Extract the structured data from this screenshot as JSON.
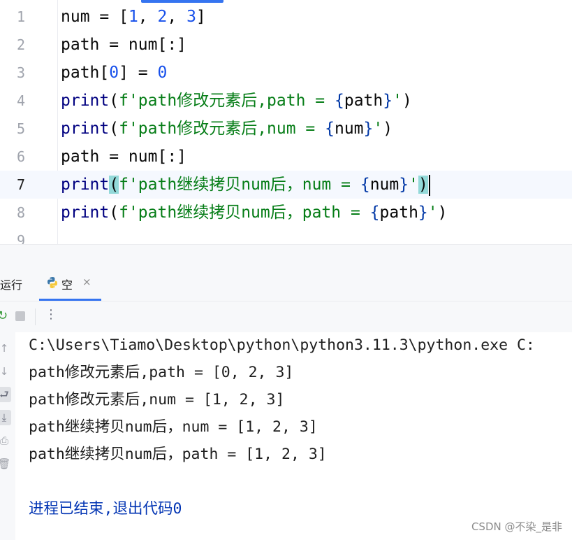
{
  "editor": {
    "current_line": 7,
    "lines": [
      {
        "n": "1",
        "tokens": [
          [
            "plain",
            "num = ["
          ],
          [
            "num",
            "1"
          ],
          [
            "plain",
            ", "
          ],
          [
            "num",
            "2"
          ],
          [
            "plain",
            ", "
          ],
          [
            "num",
            "3"
          ],
          [
            "plain",
            "]"
          ]
        ]
      },
      {
        "n": "2",
        "tokens": [
          [
            "plain",
            "path = num[:]"
          ]
        ]
      },
      {
        "n": "3",
        "tokens": [
          [
            "plain",
            "path["
          ],
          [
            "num",
            "0"
          ],
          [
            "plain",
            "] = "
          ],
          [
            "num",
            "0"
          ]
        ]
      },
      {
        "n": "4",
        "tokens": [
          [
            "kw",
            "print"
          ],
          [
            "plain",
            "("
          ],
          [
            "str",
            "f'path修改元素后,path = "
          ],
          [
            "brace",
            "{"
          ],
          [
            "plain",
            "path"
          ],
          [
            "brace",
            "}"
          ],
          [
            "str",
            "'"
          ],
          [
            "plain",
            ")"
          ]
        ]
      },
      {
        "n": "5",
        "tokens": [
          [
            "kw",
            "print"
          ],
          [
            "plain",
            "("
          ],
          [
            "str",
            "f'path修改元素后,num = "
          ],
          [
            "brace",
            "{"
          ],
          [
            "plain",
            "num"
          ],
          [
            "brace",
            "}"
          ],
          [
            "str",
            "'"
          ],
          [
            "plain",
            ")"
          ]
        ]
      },
      {
        "n": "6",
        "tokens": [
          [
            "plain",
            "path = num[:]"
          ]
        ]
      },
      {
        "n": "7",
        "tokens": [
          [
            "kw",
            "print"
          ],
          [
            "hl",
            "("
          ],
          [
            "str",
            "f'path继续拷贝num后，num = "
          ],
          [
            "brace",
            "{"
          ],
          [
            "plain",
            "num"
          ],
          [
            "brace",
            "}"
          ],
          [
            "str",
            "'"
          ],
          [
            "hl",
            ")"
          ],
          [
            "caret",
            ""
          ]
        ]
      },
      {
        "n": "8",
        "tokens": [
          [
            "kw",
            "print"
          ],
          [
            "plain",
            "("
          ],
          [
            "str",
            "f'path继续拷贝num后，path = "
          ],
          [
            "brace",
            "{"
          ],
          [
            "plain",
            "path"
          ],
          [
            "brace",
            "}"
          ],
          [
            "str",
            "'"
          ],
          [
            "plain",
            ")"
          ]
        ]
      },
      {
        "n": "9",
        "tokens": []
      }
    ]
  },
  "run_panel": {
    "title": "运行",
    "tab_label": "空",
    "tab_icon": "python-icon",
    "tab_close": "×",
    "toolbar": {
      "rerun_icon": "rerun-icon",
      "stop_icon": "stop-icon",
      "more_label": "⋮"
    },
    "side_buttons": [
      {
        "name": "up-arrow-icon",
        "glyph": "↑",
        "active": false
      },
      {
        "name": "down-arrow-icon",
        "glyph": "↓",
        "active": false
      },
      {
        "name": "soft-wrap-icon",
        "glyph": "⮐",
        "active": true
      },
      {
        "name": "scroll-to-end-icon",
        "glyph": "⤓",
        "active": true
      },
      {
        "name": "print-icon",
        "glyph": "⎙",
        "active": false
      },
      {
        "name": "trash-icon",
        "glyph": "🗑",
        "active": false
      }
    ],
    "console_lines": [
      {
        "text": "C:\\Users\\Tiamo\\Desktop\\python\\python3.11.3\\python.exe C:",
        "type": "normal"
      },
      {
        "text": "path修改元素后,path = [0, 2, 3]",
        "type": "normal"
      },
      {
        "text": "path修改元素后,num = [1, 2, 3]",
        "type": "normal"
      },
      {
        "text": "path继续拷贝num后，num = [1, 2, 3]",
        "type": "normal"
      },
      {
        "text": "path继续拷贝num后，path = [1, 2, 3]",
        "type": "normal"
      },
      {
        "text": "",
        "type": "normal"
      },
      {
        "text": "进程已结束,退出代码0",
        "type": "exit"
      }
    ]
  },
  "watermark": "CSDN @不染_是非",
  "colors": {
    "keyword": "#000080",
    "number": "#1750eb",
    "string": "#067d17",
    "accent": "#3574f0",
    "bracket_highlight": "#93d9d9"
  }
}
